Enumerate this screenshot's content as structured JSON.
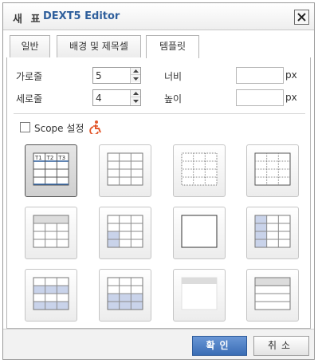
{
  "title": {
    "korean": "새 표",
    "product": "DEXT5 Editor"
  },
  "tabs": [
    {
      "label": "일반"
    },
    {
      "label": "배경 및 제목셀"
    },
    {
      "label": "템플릿"
    }
  ],
  "active_tab": "템플릿",
  "fields": {
    "cols_label": "가로줄",
    "cols_value": "5",
    "rows_label": "세로줄",
    "rows_value": "4",
    "width_label": "너비",
    "width_unit": "px",
    "height_label": "높이",
    "height_unit": "px"
  },
  "scope": {
    "label": "Scope 설정",
    "checked": false
  },
  "templates": [
    {
      "id": "header-labeled",
      "selected": true,
      "header_labels": [
        "T1",
        "T2",
        "T3"
      ]
    },
    {
      "id": "plain-grid",
      "selected": false
    },
    {
      "id": "dotted-border",
      "selected": false
    },
    {
      "id": "dotted-grid",
      "selected": false
    },
    {
      "id": "top-header-row",
      "selected": false
    },
    {
      "id": "left-column-half",
      "selected": false
    },
    {
      "id": "empty-box",
      "selected": false
    },
    {
      "id": "left-column-full",
      "selected": false
    },
    {
      "id": "blue-bands",
      "selected": false
    },
    {
      "id": "blue-bottom-rows",
      "selected": false
    },
    {
      "id": "gray-header-bar",
      "selected": false
    },
    {
      "id": "horizontal-lines",
      "selected": false
    }
  ],
  "buttons": {
    "ok": "확인",
    "cancel": "취소"
  },
  "colors": {
    "accent": "#3a6db5",
    "title_product": "#2f5f9c",
    "highlight_cell": "#c9d3ea",
    "header_gray": "#dcdcdc"
  }
}
